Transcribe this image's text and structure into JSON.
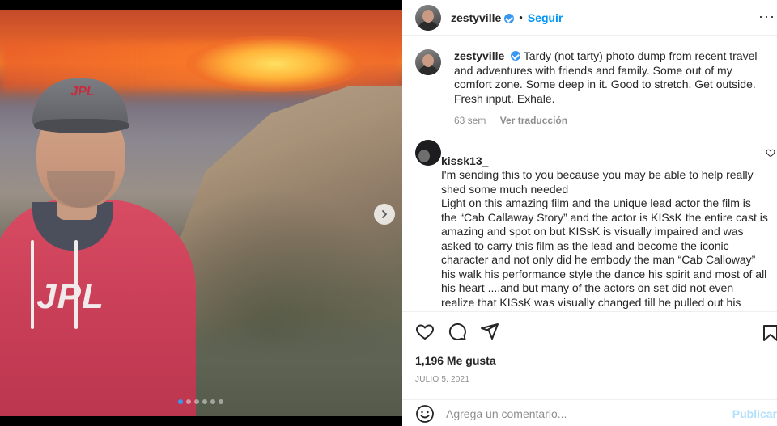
{
  "post": {
    "username": "zestyville",
    "follow_label": "Seguir",
    "more_label": "···",
    "caption": "Tardy (not tarty) photo dump from recent travel and adventures with friends and family. Some out of my comfort zone. Some deep in it. Good to stretch. Get outside. Fresh input. Exhale.",
    "caption_age": "63 sem",
    "translate_label": "Ver traducción",
    "media": {
      "cap_logo": "JPL",
      "hoodie_logo": "JPL",
      "carousel_count": 6,
      "carousel_active": 1
    }
  },
  "comments": [
    {
      "username": "kissk13_",
      "text": "I'm sending this to you because you may be able to help really shed some much needed\nLight on this amazing film and the unique lead actor the film is the “Cab Callaway Story” and the actor is KISsK the entire cast is amazing and spot on but KISsK is visually impaired and was asked to carry this film as the lead and become the iconic character and not only did he embody the man “Cab Calloway” his walk his performance style the dance his spirit and most of all his heart ....and but many of the actors on set did not even realize that KISsK was visually changed till he pulled out his walking stick and that's what dreams are mad of that's what many people would call really great acting..and that the"
    }
  ],
  "actions": {
    "likes": "1,196 Me gusta",
    "date": "JULIO 5, 2021"
  },
  "composer": {
    "placeholder": "Agrega un comentario...",
    "publish_label": "Publicar"
  }
}
